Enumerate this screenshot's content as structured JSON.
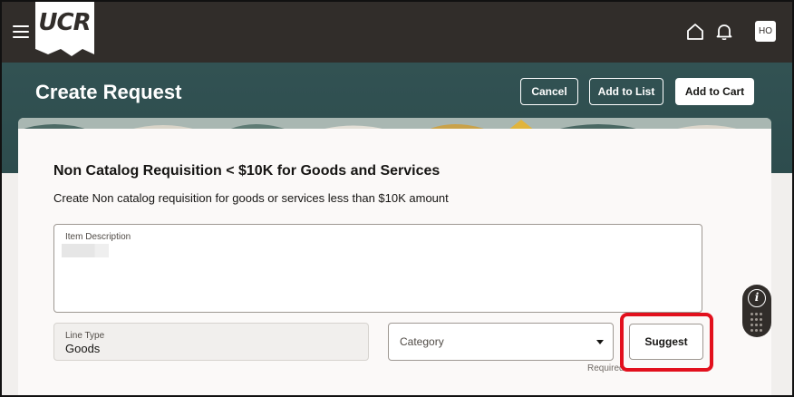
{
  "app": {
    "logo_text": "UCR",
    "avatar_initials": "HO",
    "icons": {
      "menu": "hamburger-icon",
      "home": "home-icon",
      "notifications": "bell-icon"
    }
  },
  "header": {
    "title": "Create Request",
    "buttons": {
      "cancel": "Cancel",
      "add_to_list": "Add to List",
      "add_to_cart": "Add to Cart"
    }
  },
  "form": {
    "title": "Non Catalog Requisition < $10K for Goods and Services",
    "subtitle": "Create Non catalog requisition for goods or services less than $10K amount",
    "item_description": {
      "label": "Item Description",
      "value": ""
    },
    "line_type": {
      "label": "Line Type",
      "value": "Goods"
    },
    "category": {
      "placeholder": "Category",
      "value": ""
    },
    "required_text": "Required",
    "suggest_label": "Suggest"
  },
  "colors": {
    "topbar": "#312d2a",
    "header_band": "#2f4f4f",
    "highlight": "#e2101d"
  }
}
